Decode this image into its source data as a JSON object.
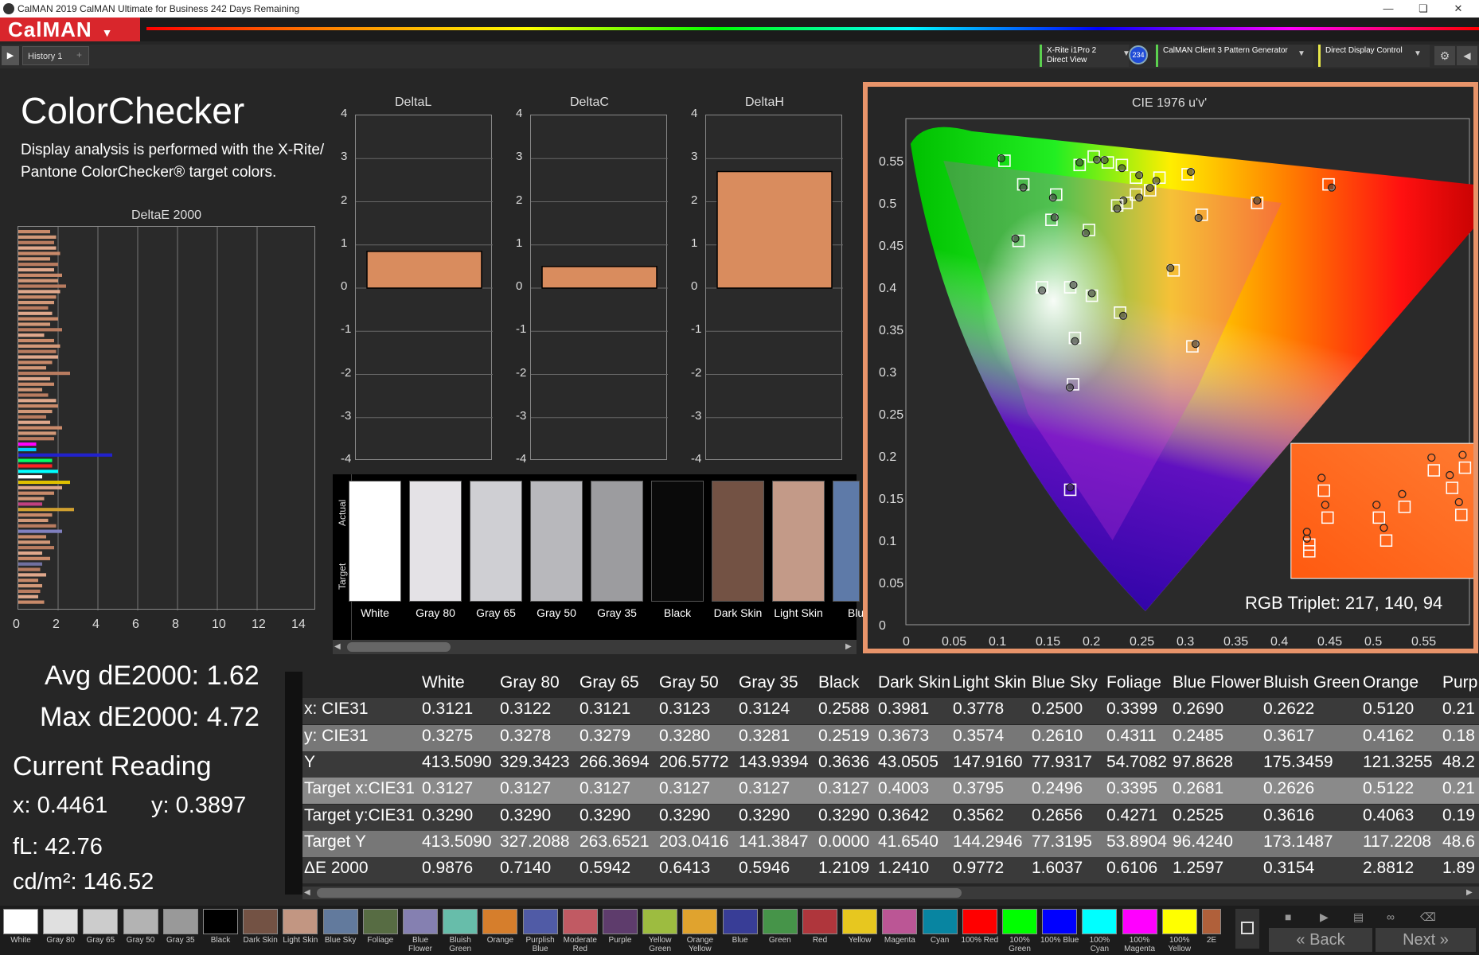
{
  "window": {
    "title": "CalMAN 2019 CalMAN Ultimate for Business 242 Days Remaining"
  },
  "app": {
    "logo": "CalMAN",
    "tab": "History 1"
  },
  "devices": [
    {
      "line1": "X-Rite i1Pro 2",
      "line2": "Direct View",
      "badge": "234"
    },
    {
      "line1": "CalMAN Client 3 Pattern Generator",
      "line2": ""
    },
    {
      "line1": "Direct Display Control",
      "line2": ""
    }
  ],
  "colorchecker": {
    "title": "ColorChecker",
    "desc1": "Display analysis is performed with the X-Rite/",
    "desc2": "Pantone ColorChecker® target colors.",
    "de_title": "DeltaE 2000",
    "de_xticks": [
      "0",
      "2",
      "4",
      "6",
      "8",
      "10",
      "12",
      "14"
    ]
  },
  "delta_charts": [
    {
      "title": "DeltaL",
      "value": 0.85
    },
    {
      "title": "DeltaC",
      "value": 0.5
    },
    {
      "title": "DeltaH",
      "value": 2.7
    }
  ],
  "delta_yticks": [
    "4",
    "3",
    "2",
    "1",
    "0",
    "-1",
    "-2",
    "-3",
    "-4"
  ],
  "swatches": {
    "actual_label": "Actual",
    "target_label": "Target",
    "items": [
      {
        "name": "White",
        "color": "#ffffff"
      },
      {
        "name": "Gray 80",
        "color": "#e4e2e6"
      },
      {
        "name": "Gray 65",
        "color": "#cfcfd3"
      },
      {
        "name": "Gray 50",
        "color": "#b8b8bc"
      },
      {
        "name": "Gray 35",
        "color": "#9c9c9f"
      },
      {
        "name": "Black",
        "color": "#0a0a0a"
      },
      {
        "name": "Dark Skin",
        "color": "#735244"
      },
      {
        "name": "Light Skin",
        "color": "#c39a88"
      },
      {
        "name": "Blue",
        "color": "#5e7aa8"
      }
    ]
  },
  "stats": {
    "avg": "Avg dE2000: 1.62",
    "max": "Max dE2000: 4.72",
    "current": "Current Reading",
    "x": "x: 0.4461",
    "y": "y: 0.3897",
    "fl": "fL: 42.76",
    "cdm": "cd/m²: 146.52"
  },
  "cie": {
    "title": "CIE 1976 u'v'",
    "rgb_triplet": "RGB Triplet: 217, 140, 94",
    "yticks": [
      "0.55",
      "0.5",
      "0.45",
      "0.4",
      "0.35",
      "0.3",
      "0.25",
      "0.2",
      "0.15",
      "0.1",
      "0.05",
      "0"
    ],
    "xticks": [
      "0",
      "0.05",
      "0.1",
      "0.15",
      "0.2",
      "0.25",
      "0.3",
      "0.35",
      "0.4",
      "0.45",
      "0.5",
      "0.55"
    ]
  },
  "table": {
    "columns": [
      "White",
      "Gray 80",
      "Gray 65",
      "Gray 50",
      "Gray 35",
      "Black",
      "Dark Skin",
      "Light Skin",
      "Blue Sky",
      "Foliage",
      "Blue Flower",
      "Bluish Green",
      "Orange",
      "Purp"
    ],
    "rows": [
      {
        "label": "x: CIE31",
        "values": [
          "0.3121",
          "0.3122",
          "0.3121",
          "0.3123",
          "0.3124",
          "0.2588",
          "0.3981",
          "0.3778",
          "0.2500",
          "0.3399",
          "0.2690",
          "0.2622",
          "0.5120",
          "0.21"
        ]
      },
      {
        "label": "y: CIE31",
        "values": [
          "0.3275",
          "0.3278",
          "0.3279",
          "0.3280",
          "0.3281",
          "0.2519",
          "0.3673",
          "0.3574",
          "0.2610",
          "0.4311",
          "0.2485",
          "0.3617",
          "0.4162",
          "0.18"
        ]
      },
      {
        "label": "Y",
        "values": [
          "413.5090",
          "329.3423",
          "266.3694",
          "206.5772",
          "143.9394",
          "0.3636",
          "43.0505",
          "147.9160",
          "77.9317",
          "54.7082",
          "97.8628",
          "175.3459",
          "121.3255",
          "48.2"
        ]
      },
      {
        "label": "Target x:CIE31",
        "values": [
          "0.3127",
          "0.3127",
          "0.3127",
          "0.3127",
          "0.3127",
          "0.3127",
          "0.4003",
          "0.3795",
          "0.2496",
          "0.3395",
          "0.2681",
          "0.2626",
          "0.5122",
          "0.21"
        ]
      },
      {
        "label": "Target y:CIE31",
        "values": [
          "0.3290",
          "0.3290",
          "0.3290",
          "0.3290",
          "0.3290",
          "0.3290",
          "0.3642",
          "0.3562",
          "0.2656",
          "0.4271",
          "0.2525",
          "0.3616",
          "0.4063",
          "0.19"
        ]
      },
      {
        "label": "Target Y",
        "values": [
          "413.5090",
          "327.2088",
          "263.6521",
          "203.0416",
          "141.3847",
          "0.0000",
          "41.6540",
          "144.2946",
          "77.3195",
          "53.8904",
          "96.4240",
          "173.1487",
          "117.2208",
          "48.6"
        ]
      },
      {
        "label": "ΔE 2000",
        "values": [
          "0.9876",
          "0.7140",
          "0.5942",
          "0.6413",
          "0.5946",
          "1.2109",
          "1.2410",
          "0.9772",
          "1.6037",
          "0.6106",
          "1.2597",
          "0.3154",
          "2.8812",
          "1.89"
        ]
      }
    ]
  },
  "bottom_swatches": [
    {
      "label": "White",
      "color": "#ffffff"
    },
    {
      "label": "Gray 80",
      "color": "#e0e0e0"
    },
    {
      "label": "Gray 65",
      "color": "#cccccc"
    },
    {
      "label": "Gray 50",
      "color": "#b3b3b3"
    },
    {
      "label": "Gray 35",
      "color": "#999999"
    },
    {
      "label": "Black",
      "color": "#000000"
    },
    {
      "label": "Dark Skin",
      "color": "#735244"
    },
    {
      "label": "Light Skin",
      "color": "#c29682"
    },
    {
      "label": "Blue Sky",
      "color": "#627a9d"
    },
    {
      "label": "Foliage",
      "color": "#576c43"
    },
    {
      "label": "Blue Flower",
      "color": "#8580b1"
    },
    {
      "label": "Bluish Green",
      "color": "#67bdaa"
    },
    {
      "label": "Orange",
      "color": "#d67e2c"
    },
    {
      "label": "Purplish Blue",
      "color": "#505ba6"
    },
    {
      "label": "Moderate Red",
      "color": "#c15a63"
    },
    {
      "label": "Purple",
      "color": "#5e3c6c"
    },
    {
      "label": "Yellow Green",
      "color": "#9dbc40"
    },
    {
      "label": "Orange Yellow",
      "color": "#e0a32e"
    },
    {
      "label": "Blue",
      "color": "#383d96"
    },
    {
      "label": "Green",
      "color": "#469449"
    },
    {
      "label": "Red",
      "color": "#af363c"
    },
    {
      "label": "Yellow",
      "color": "#e7c71f"
    },
    {
      "label": "Magenta",
      "color": "#bb5695"
    },
    {
      "label": "Cyan",
      "color": "#0885a1"
    },
    {
      "label": "100% Red",
      "color": "#ff0000"
    },
    {
      "label": "100% Green",
      "color": "#00ff00"
    },
    {
      "label": "100% Blue",
      "color": "#0000ff"
    },
    {
      "label": "100% Cyan",
      "color": "#00ffff"
    },
    {
      "label": "100% Magenta",
      "color": "#ff00ff"
    },
    {
      "label": "100% Yellow",
      "color": "#ffff00"
    },
    {
      "label": "2E",
      "color": "#b0603a"
    }
  ],
  "nav": {
    "back": "Back",
    "next": "Next"
  }
}
